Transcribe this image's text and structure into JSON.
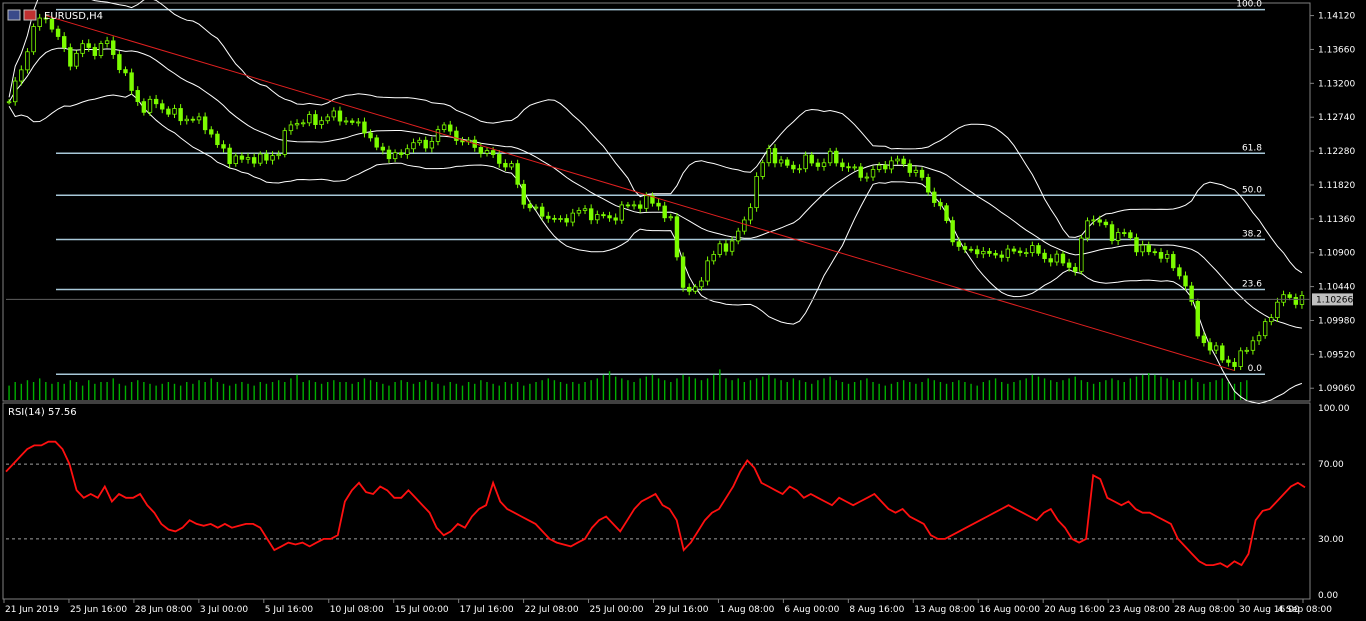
{
  "window": {
    "symbol_label": "EURUSD,H4",
    "colors": {
      "background": "#000000",
      "candle": "#7CFC00",
      "volume": "#00b000",
      "bands": "#ffffff",
      "fib": "#a8c8d8",
      "trendline": "#e02020",
      "rsi": "#ff1010",
      "grid_text": "#ffffff",
      "price_tag_bg": "#c0c0c0"
    }
  },
  "chart_data": [
    {
      "type": "candlestick",
      "title": "EURUSD,H4",
      "ylim": [
        1.089,
        1.1425
      ],
      "y_ticks": [
        "1.14120",
        "1.13660",
        "1.13200",
        "1.12740",
        "1.12280",
        "1.11820",
        "1.11360",
        "1.10900",
        "1.10440",
        "1.09980",
        "1.09520",
        "1.09060"
      ],
      "current_price": "1.10266",
      "x_tick_labels": [
        "21 Jun 2019",
        "25 Jun 16:00",
        "28 Jun 08:00",
        "3 Jul 00:00",
        "5 Jul 16:00",
        "10 Jul 08:00",
        "15 Jul 00:00",
        "17 Jul 16:00",
        "22 Jul 08:00",
        "25 Jul 00:00",
        "29 Jul 16:00",
        "1 Aug 08:00",
        "6 Aug 00:00",
        "8 Aug 16:00",
        "13 Aug 08:00",
        "16 Aug 00:00",
        "20 Aug 16:00",
        "23 Aug 08:00",
        "28 Aug 08:00",
        "30 Aug 16:00",
        "4 Sep 08:00"
      ],
      "close_path": [
        [
          0,
          1.1295
        ],
        [
          2,
          1.134
        ],
        [
          4,
          1.1395
        ],
        [
          6,
          1.1412
        ],
        [
          8,
          1.138
        ],
        [
          10,
          1.135
        ],
        [
          12,
          1.137
        ],
        [
          14,
          1.1365
        ],
        [
          16,
          1.1375
        ],
        [
          18,
          1.1345
        ],
        [
          20,
          1.131
        ],
        [
          22,
          1.1285
        ],
        [
          24,
          1.1295
        ],
        [
          26,
          1.128
        ],
        [
          28,
          1.1275
        ],
        [
          30,
          1.127
        ],
        [
          32,
          1.1265
        ],
        [
          34,
          1.1235
        ],
        [
          36,
          1.122
        ],
        [
          38,
          1.1215
        ],
        [
          40,
          1.122
        ],
        [
          42,
          1.1215
        ],
        [
          44,
          1.123
        ],
        [
          46,
          1.1265
        ],
        [
          48,
          1.127
        ],
        [
          50,
          1.1268
        ],
        [
          52,
          1.1275
        ],
        [
          54,
          1.1275
        ],
        [
          56,
          1.1265
        ],
        [
          58,
          1.126
        ],
        [
          60,
          1.123
        ],
        [
          62,
          1.1225
        ],
        [
          64,
          1.122
        ],
        [
          66,
          1.1245
        ],
        [
          68,
          1.123
        ],
        [
          70,
          1.126
        ],
        [
          72,
          1.1255
        ],
        [
          74,
          1.124
        ],
        [
          76,
          1.1235
        ],
        [
          78,
          1.1225
        ],
        [
          80,
          1.1215
        ],
        [
          82,
          1.1205
        ],
        [
          84,
          1.116
        ],
        [
          86,
          1.1145
        ],
        [
          88,
          1.114
        ],
        [
          90,
          1.113
        ],
        [
          92,
          1.1145
        ],
        [
          94,
          1.1145
        ],
        [
          96,
          1.114
        ],
        [
          98,
          1.1135
        ],
        [
          100,
          1.115
        ],
        [
          102,
          1.1155
        ],
        [
          104,
          1.116
        ],
        [
          106,
          1.1155
        ],
        [
          108,
          1.113
        ],
        [
          110,
          1.1045
        ],
        [
          112,
          1.1035
        ],
        [
          114,
          1.108
        ],
        [
          116,
          1.1095
        ],
        [
          118,
          1.1105
        ],
        [
          120,
          1.113
        ],
        [
          122,
          1.119
        ],
        [
          124,
          1.123
        ],
        [
          126,
          1.121
        ],
        [
          128,
          1.1205
        ],
        [
          130,
          1.1215
        ],
        [
          132,
          1.121
        ],
        [
          134,
          1.122
        ],
        [
          136,
          1.121
        ],
        [
          138,
          1.12
        ],
        [
          140,
          1.1195
        ],
        [
          142,
          1.1205
        ],
        [
          144,
          1.1215
        ],
        [
          146,
          1.121
        ],
        [
          148,
          1.12
        ],
        [
          150,
          1.1175
        ],
        [
          152,
          1.115
        ],
        [
          154,
          1.111
        ],
        [
          156,
          1.109
        ],
        [
          158,
          1.1095
        ],
        [
          160,
          1.1085
        ],
        [
          162,
          1.109
        ],
        [
          164,
          1.109
        ],
        [
          166,
          1.1095
        ],
        [
          168,
          1.109
        ],
        [
          170,
          1.108
        ],
        [
          172,
          1.108
        ],
        [
          174,
          1.1065
        ],
        [
          176,
          1.114
        ],
        [
          178,
          1.113
        ],
        [
          180,
          1.1115
        ],
        [
          182,
          1.1115
        ],
        [
          184,
          1.11
        ],
        [
          186,
          1.109
        ],
        [
          188,
          1.109
        ],
        [
          190,
          1.107
        ],
        [
          192,
          1.105
        ],
        [
          194,
          1.098
        ],
        [
          196,
          1.096
        ],
        [
          198,
          1.095
        ],
        [
          200,
          1.0935
        ],
        [
          202,
          1.0965
        ],
        [
          204,
          1.0975
        ],
        [
          206,
          1.101
        ],
        [
          208,
          1.103
        ],
        [
          210,
          1.1027
        ]
      ],
      "total_bars": 212,
      "fibonacci": [
        {
          "label": "100.0",
          "price": 1.142
        },
        {
          "label": "61.8",
          "price": 1.1225
        },
        {
          "label": "50.0",
          "price": 1.1168
        },
        {
          "label": "38.2",
          "price": 1.1108
        },
        {
          "label": "23.6",
          "price": 1.104
        },
        {
          "label": "0.0",
          "price": 1.0925
        }
      ],
      "trendline": [
        [
          6,
          1.1412
        ],
        [
          200,
          1.093
        ]
      ]
    },
    {
      "type": "line",
      "title": "RSI(14) 57.56",
      "ylim": [
        0,
        100
      ],
      "levels": [
        70,
        30
      ],
      "y_ticks": [
        "100.00",
        "70.00",
        "30.00",
        "0.00"
      ],
      "values": [
        66,
        70,
        74,
        78,
        80,
        80,
        82,
        82,
        78,
        70,
        56,
        52,
        54,
        52,
        58,
        50,
        54,
        52,
        52,
        54,
        48,
        44,
        38,
        35,
        34,
        36,
        40,
        38,
        37,
        38,
        36,
        38,
        36,
        37,
        38,
        38,
        36,
        30,
        24,
        26,
        28,
        27,
        28,
        26,
        28,
        30,
        30,
        32,
        50,
        56,
        60,
        55,
        54,
        58,
        56,
        52,
        52,
        56,
        52,
        48,
        44,
        36,
        32,
        34,
        38,
        36,
        42,
        46,
        48,
        60,
        50,
        46,
        44,
        42,
        40,
        38,
        34,
        30,
        28,
        27,
        26,
        28,
        30,
        36,
        40,
        42,
        38,
        34,
        40,
        46,
        50,
        52,
        54,
        48,
        46,
        40,
        24,
        28,
        34,
        40,
        44,
        46,
        52,
        58,
        66,
        72,
        68,
        60,
        58,
        56,
        54,
        58,
        56,
        52,
        54,
        52,
        50,
        48,
        52,
        50,
        48,
        50,
        52,
        54,
        50,
        46,
        44,
        46,
        42,
        40,
        38,
        32,
        30,
        30,
        32,
        34,
        36,
        38,
        40,
        42,
        44,
        46,
        48,
        46,
        44,
        42,
        40,
        44,
        46,
        40,
        36,
        30,
        28,
        30,
        64,
        62,
        52,
        50,
        48,
        50,
        46,
        44,
        44,
        42,
        40,
        38,
        30,
        26,
        22,
        18,
        16,
        16,
        17,
        15,
        18,
        16,
        22,
        40,
        45,
        46,
        50,
        54,
        58,
        60,
        57.56
      ]
    },
    {
      "type": "bar",
      "title": "",
      "ylim": [
        0,
        1
      ],
      "values": [
        0.4,
        0.5,
        0.45,
        0.55,
        0.5,
        0.6,
        0.5,
        0.45,
        0.5,
        0.45,
        0.55,
        0.5,
        0.4,
        0.55,
        0.45,
        0.5,
        0.5,
        0.6,
        0.45,
        0.4,
        0.5,
        0.55,
        0.5,
        0.45,
        0.4,
        0.45,
        0.5,
        0.45,
        0.4,
        0.5,
        0.45,
        0.55,
        0.5,
        0.6,
        0.5,
        0.45,
        0.4,
        0.45,
        0.5,
        0.45,
        0.4,
        0.5,
        0.45,
        0.5,
        0.55,
        0.5,
        0.6,
        0.7,
        0.5,
        0.55,
        0.5,
        0.45,
        0.5,
        0.55,
        0.5,
        0.5,
        0.45,
        0.5,
        0.6,
        0.55,
        0.5,
        0.45,
        0.4,
        0.5,
        0.55,
        0.5,
        0.45,
        0.5,
        0.55,
        0.5,
        0.45,
        0.4,
        0.5,
        0.45,
        0.4,
        0.5,
        0.45,
        0.55,
        0.5,
        0.45,
        0.4,
        0.5,
        0.45,
        0.5,
        0.4,
        0.45,
        0.5,
        0.55,
        0.6,
        0.55,
        0.5,
        0.45,
        0.5,
        0.45,
        0.5,
        0.55,
        0.6,
        0.7,
        0.8,
        0.65,
        0.6,
        0.55,
        0.5,
        0.6,
        0.65,
        0.7,
        0.6,
        0.55,
        0.5,
        0.6,
        0.7,
        0.65,
        0.6,
        0.55,
        0.6,
        0.7,
        0.85,
        0.6,
        0.55,
        0.6,
        0.5,
        0.55,
        0.6,
        0.65,
        0.7,
        0.6,
        0.55,
        0.5,
        0.6,
        0.55,
        0.5,
        0.45,
        0.55,
        0.6,
        0.65,
        0.55,
        0.5,
        0.45,
        0.5,
        0.55,
        0.6,
        0.5,
        0.45,
        0.4,
        0.45,
        0.5,
        0.55,
        0.5,
        0.45,
        0.5,
        0.6,
        0.55,
        0.5,
        0.45,
        0.5,
        0.55,
        0.5,
        0.45,
        0.4,
        0.5,
        0.55,
        0.6,
        0.5,
        0.45,
        0.5,
        0.55,
        0.6,
        0.7,
        0.65,
        0.6,
        0.55,
        0.5,
        0.55,
        0.6,
        0.65,
        0.55,
        0.5,
        0.45,
        0.5,
        0.55,
        0.6,
        0.55,
        0.5,
        0.6,
        0.65,
        0.7,
        0.75,
        0.7,
        0.65,
        0.6,
        0.55,
        0.5,
        0.55,
        0.6,
        0.5,
        0.45,
        0.5,
        0.55,
        0.6,
        0.5,
        0.45,
        0.5,
        0.55
      ]
    }
  ]
}
